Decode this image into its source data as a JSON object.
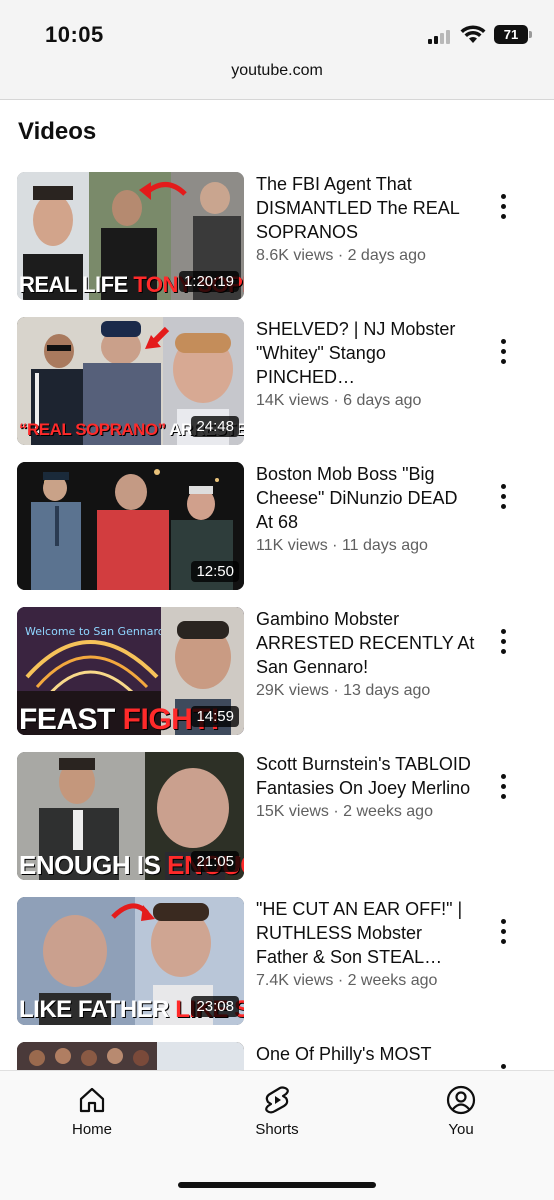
{
  "status_bar": {
    "time": "10:05",
    "battery": "71",
    "url": "youtube.com"
  },
  "section": {
    "title": "Videos"
  },
  "videos": [
    {
      "title": "The FBI Agent That DISMANTLED The REAL SOPRANOS",
      "meta": "8.6K views · 2 days ago",
      "duration": "1:20:19",
      "caption_white": "REAL LIFE ",
      "caption_red": "TONY SOPRANO?"
    },
    {
      "title": "SHELVED? | NJ Mobster \"Whitey\" Stango PINCHED…",
      "meta": "14K views · 6 days ago",
      "duration": "24:48",
      "caption_white": "ARRESTED AGAIN",
      "caption_red": "“REAL SOPRANO” "
    },
    {
      "title": "Boston Mob Boss \"Big Cheese\" DiNunzio DEAD At 68",
      "meta": "11K views · 11 days ago",
      "duration": "12:50",
      "caption_white": "",
      "caption_red": ""
    },
    {
      "title": "Gambino Mobster ARRESTED RECENTLY At San Gennaro!",
      "meta": "29K views · 13 days ago",
      "duration": "14:59",
      "caption_white": "FEAST ",
      "caption_red": "FIGHT!"
    },
    {
      "title": "Scott Burnstein's TABLOID Fantasies On Joey Merlino",
      "meta": "15K views · 2 weeks ago",
      "duration": "21:05",
      "caption_white": "ENOUGH IS ",
      "caption_red": "ENOUGH"
    },
    {
      "title": "\"HE CUT AN EAR OFF!\" | RUTHLESS Mobster Father & Son STEAL…",
      "meta": "7.4K views · 2 weeks ago",
      "duration": "23:08",
      "caption_white": "LIKE FATHER ",
      "caption_red": "LIKE SON"
    },
    {
      "title": "One Of Philly's MOST",
      "meta": "",
      "duration": "",
      "caption_white": "",
      "caption_red": ""
    }
  ],
  "thumbnail_sign_text": "Welcome to San Gennaro",
  "nav": {
    "home": "Home",
    "shorts": "Shorts",
    "you": "You"
  },
  "colors": {
    "accent_red": "#ff2a2a",
    "meta_gray": "#606060"
  }
}
